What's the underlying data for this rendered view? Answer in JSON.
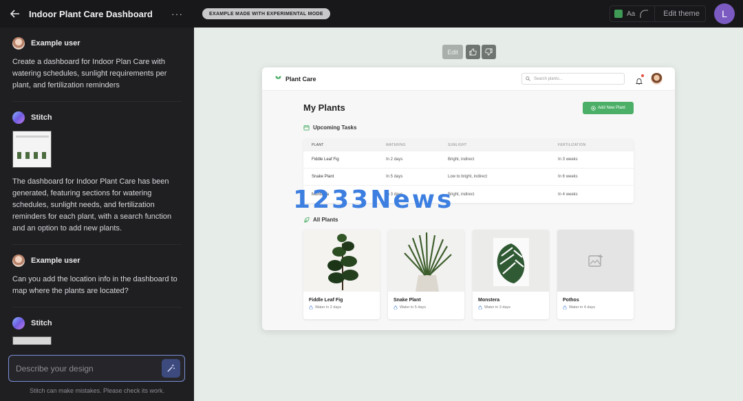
{
  "sidebar": {
    "title": "Indoor Plant Care Dashboard",
    "more_label": "···",
    "messages": [
      {
        "author": "Example user",
        "text": "Create a dashboard for Indoor Plan Care with watering schedules, sunlight requirements per plant, and fertilization reminders"
      },
      {
        "author": "Stitch",
        "text": "The dashboard for Indoor Plant Care has been generated, featuring sections for watering schedules, sunlight needs, and fertilization reminders for each plant, with a search function and an option to add new plants."
      },
      {
        "author": "Example user",
        "text": "Can you add the location info in the dashboard to map where the plants are located?"
      },
      {
        "author": "Stitch",
        "text": ""
      }
    ],
    "composer_placeholder": "Describe your design",
    "disclaimer": "Stitch can make mistakes. Please check its work."
  },
  "topbar": {
    "experimental_label": "EXAMPLE MADE WITH EXPERIMENTAL MODE",
    "font_label": "Aa",
    "edit_theme_label": "Edit theme",
    "avatar_initial": "L",
    "theme_color": "#3f9a56"
  },
  "canvas": {
    "edit_label": "Edit"
  },
  "app": {
    "logo": "Plant Care",
    "search_placeholder": "Search plants...",
    "page_title": "My Plants",
    "add_button": "Add New Plant",
    "tasks_heading": "Upcoming Tasks",
    "columns": [
      "PLANT",
      "WATERING",
      "SUNLIGHT",
      "FERTILIZATION"
    ],
    "rows": [
      [
        "Fiddle Leaf Fig",
        "In 2 days",
        "Bright, indirect",
        "In 3 weeks"
      ],
      [
        "Snake Plant",
        "In 5 days",
        "Low to bright, indirect",
        "In 6 weeks"
      ],
      [
        "Monstera",
        "In 3 days",
        "Bright, indirect",
        "In 4 weeks"
      ]
    ],
    "plants_heading": "All Plants",
    "cards": [
      {
        "name": "Fiddle Leaf Fig",
        "water": "Water in 2 days"
      },
      {
        "name": "Snake Plant",
        "water": "Water in 5 days"
      },
      {
        "name": "Monstera",
        "water": "Water in 3 days"
      },
      {
        "name": "Pothos",
        "water": "Water in 4 days"
      }
    ],
    "accent": "#4caf68"
  },
  "watermark": "1233News"
}
